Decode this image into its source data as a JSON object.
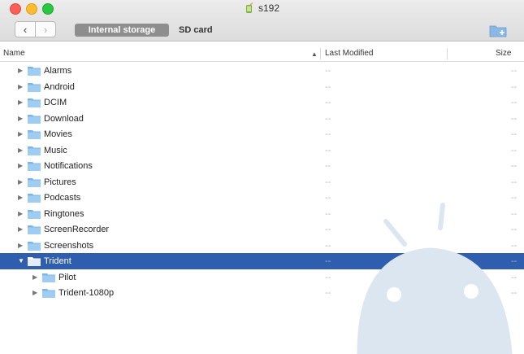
{
  "window": {
    "title": "s192",
    "title_icon": "android-device-icon"
  },
  "toolbar": {
    "back_icon": "chevron-left-icon",
    "forward_icon": "chevron-right-icon",
    "tabs": [
      {
        "label": "Internal storage",
        "active": true
      },
      {
        "label": "SD card",
        "active": false
      }
    ],
    "new_folder_icon": "new-folder-icon"
  },
  "columns": {
    "name": "Name",
    "last_modified": "Last Modified",
    "size": "Size"
  },
  "files": [
    {
      "name": "Alarms",
      "modified": "--",
      "size": "--",
      "expanded": false,
      "level": 0,
      "selected": false
    },
    {
      "name": "Android",
      "modified": "--",
      "size": "--",
      "expanded": false,
      "level": 0,
      "selected": false
    },
    {
      "name": "DCIM",
      "modified": "--",
      "size": "--",
      "expanded": false,
      "level": 0,
      "selected": false
    },
    {
      "name": "Download",
      "modified": "--",
      "size": "--",
      "expanded": false,
      "level": 0,
      "selected": false
    },
    {
      "name": "Movies",
      "modified": "--",
      "size": "--",
      "expanded": false,
      "level": 0,
      "selected": false
    },
    {
      "name": "Music",
      "modified": "--",
      "size": "--",
      "expanded": false,
      "level": 0,
      "selected": false
    },
    {
      "name": "Notifications",
      "modified": "--",
      "size": "--",
      "expanded": false,
      "level": 0,
      "selected": false
    },
    {
      "name": "Pictures",
      "modified": "--",
      "size": "--",
      "expanded": false,
      "level": 0,
      "selected": false
    },
    {
      "name": "Podcasts",
      "modified": "--",
      "size": "--",
      "expanded": false,
      "level": 0,
      "selected": false
    },
    {
      "name": "Ringtones",
      "modified": "--",
      "size": "--",
      "expanded": false,
      "level": 0,
      "selected": false
    },
    {
      "name": "ScreenRecorder",
      "modified": "--",
      "size": "--",
      "expanded": false,
      "level": 0,
      "selected": false
    },
    {
      "name": "Screenshots",
      "modified": "--",
      "size": "--",
      "expanded": false,
      "level": 0,
      "selected": false
    },
    {
      "name": "Trident",
      "modified": "--",
      "size": "--",
      "expanded": true,
      "level": 0,
      "selected": true
    },
    {
      "name": "Pilot",
      "modified": "--",
      "size": "--",
      "expanded": false,
      "level": 1,
      "selected": false
    },
    {
      "name": "Trident-1080p",
      "modified": "--",
      "size": "--",
      "expanded": false,
      "level": 1,
      "selected": false
    }
  ],
  "colors": {
    "selection": "#2f5eaf",
    "folder": "#7cb6e8",
    "watermark": "#dbe6f1"
  }
}
